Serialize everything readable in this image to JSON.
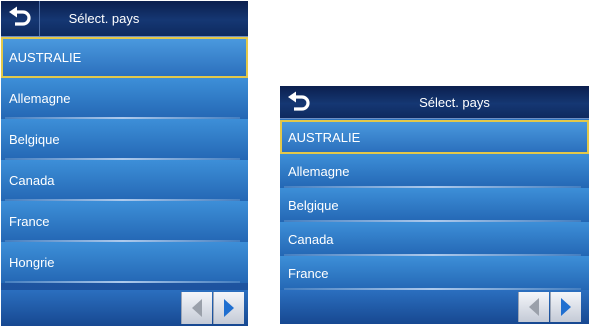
{
  "screens": [
    {
      "title": "Sélect. pays",
      "countries": [
        "AUSTRALIE",
        "Allemagne",
        "Belgique",
        "Canada",
        "France",
        "Hongrie"
      ],
      "selected_index": 0
    },
    {
      "title": "Sélect. pays",
      "countries": [
        "AUSTRALIE",
        "Allemagne",
        "Belgique",
        "Canada",
        "France"
      ],
      "selected_index": 0
    }
  ],
  "icons": {
    "back": "back-arrow-icon",
    "prev": "left-triangle-icon",
    "next": "right-triangle-icon"
  },
  "colors": {
    "title_bar": "#153773",
    "list_row": "#2f7cc9",
    "selection_border": "#e3c84a",
    "next_arrow": "#1f6fd0",
    "prev_arrow": "#9aa0aa"
  }
}
